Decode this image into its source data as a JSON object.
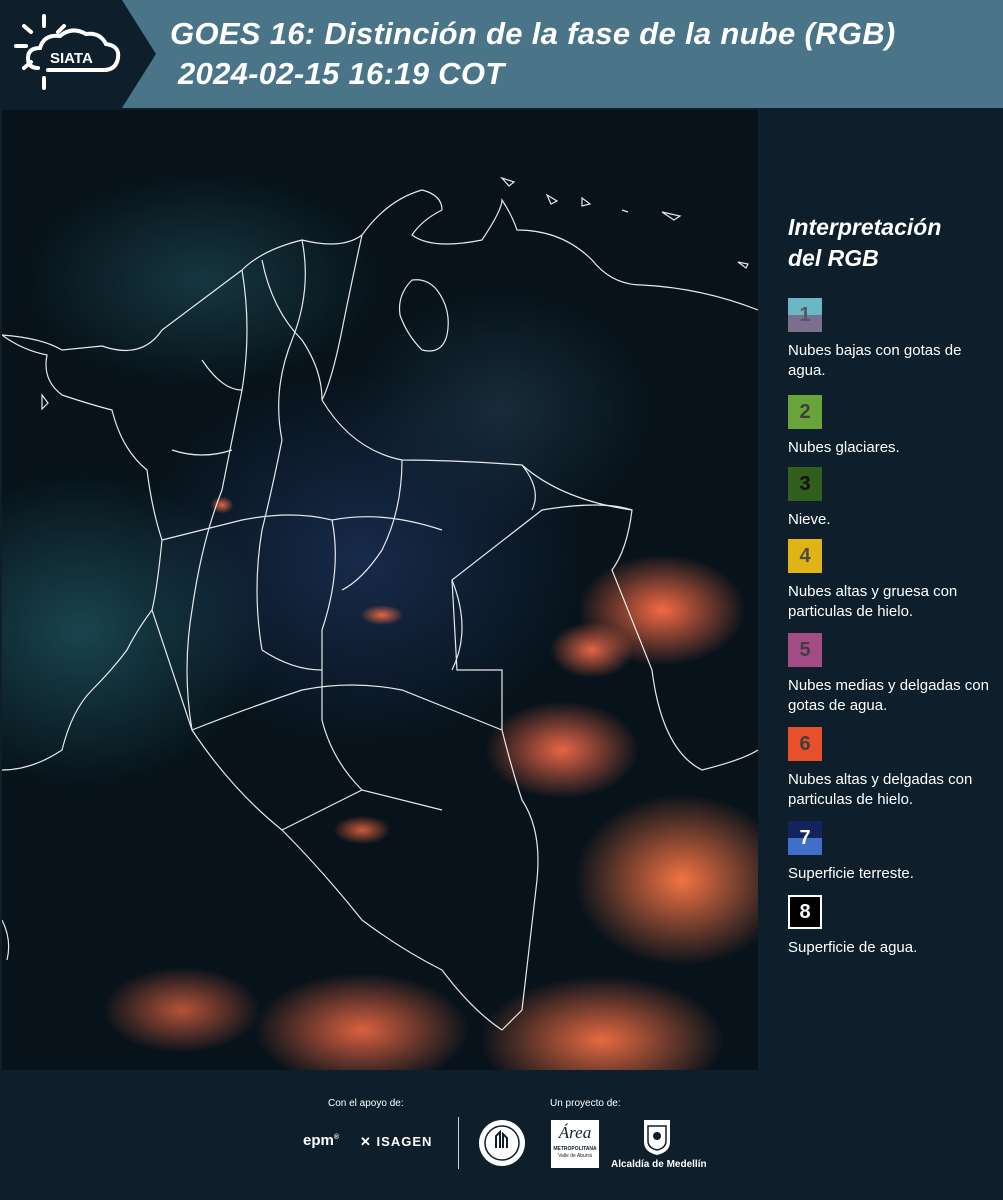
{
  "header": {
    "logo_text": "SIATA",
    "title_line1": "GOES 16: Distinción de la fase de la nube (RGB)",
    "title_line2": "2024-02-15 16:19 COT"
  },
  "legend": {
    "title_line1": "Interpretación",
    "title_line2": "del RGB",
    "items": [
      {
        "num": "1",
        "label": "Nubes bajas con gotas de agua.",
        "color_top": "#6bb8c4",
        "color_bottom": "#7a6f8c",
        "text_color": "#555566"
      },
      {
        "num": "2",
        "label": "Nubes glaciares.",
        "color": "#68a43a",
        "text_color": "#3d3d3d"
      },
      {
        "num": "3",
        "label": "Nieve.",
        "color": "#2f5e1d",
        "text_color": "#111111"
      },
      {
        "num": "4",
        "label": "Nubes altas y gruesa con particulas de hielo.",
        "color": "#e0b316",
        "text_color": "#4a4a4a"
      },
      {
        "num": "5",
        "label": "Nubes medias y delgadas con gotas de agua.",
        "color": "#a34c86",
        "text_color": "#3f3f3f"
      },
      {
        "num": "6",
        "label": "Nubes altas y delgadas con particulas de hielo.",
        "color": "#e8502c",
        "text_color": "#3f3f3f"
      },
      {
        "num": "7",
        "label": "Superficie terreste.",
        "color_top": "#13235e",
        "color_bottom": "#3f6fc8",
        "text_color": "#ffffff"
      },
      {
        "num": "8",
        "label": "Superficie de agua.",
        "color": "#000000",
        "text_color": "#ffffff",
        "border": "#ffffff"
      }
    ]
  },
  "footer": {
    "support_label": "Con el apoyo de:",
    "project_label": "Un proyecto de:",
    "sponsor1": "epm",
    "sponsor2": "ISAGEN",
    "area_logo_big": "Área",
    "area_logo_line1": "METROPOLITANA",
    "area_logo_line2": "Valle de Aburrá",
    "medellin_label": "Alcaldía de Medellín"
  }
}
